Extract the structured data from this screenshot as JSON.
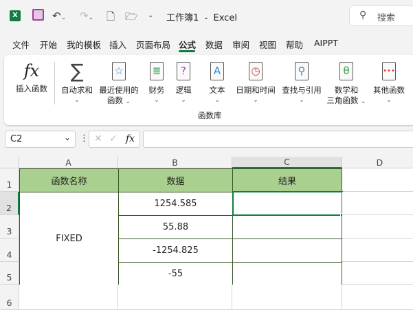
{
  "titlebar": {
    "title": "工作簿1  -  Excel",
    "search_placeholder": "搜索"
  },
  "tabs": [
    "文件",
    "开始",
    "我的模板",
    "插入",
    "页面布局",
    "公式",
    "数据",
    "审阅",
    "视图",
    "帮助",
    "AIPPT"
  ],
  "active_tab": "公式",
  "ribbon": {
    "insert_function": "插入函数",
    "autosum": "自动求和",
    "recent_1": "最近使用的",
    "recent_2": "函数",
    "financial": "财务",
    "logical": "逻辑",
    "text": "文本",
    "datetime": "日期和时间",
    "lookup": "查找与引用",
    "math_1": "数学和",
    "math_2": "三角函数",
    "more": "其他函数",
    "group_label": "函数库"
  },
  "formula_bar": {
    "name_box": "C2",
    "fx": "fx",
    "value": ""
  },
  "columns": [
    "A",
    "B",
    "C",
    "D"
  ],
  "rows": [
    "1",
    "2",
    "3",
    "4",
    "5",
    "6"
  ],
  "table": {
    "header": [
      "函数名称",
      "数据",
      "结果"
    ],
    "function_name": "FIXED",
    "data": [
      "1254.585",
      "55.88",
      "-1254.825",
      "-55"
    ]
  },
  "colors": {
    "header_fill": "#a9d08e",
    "border": "#375623",
    "excel_green": "#107c41"
  }
}
